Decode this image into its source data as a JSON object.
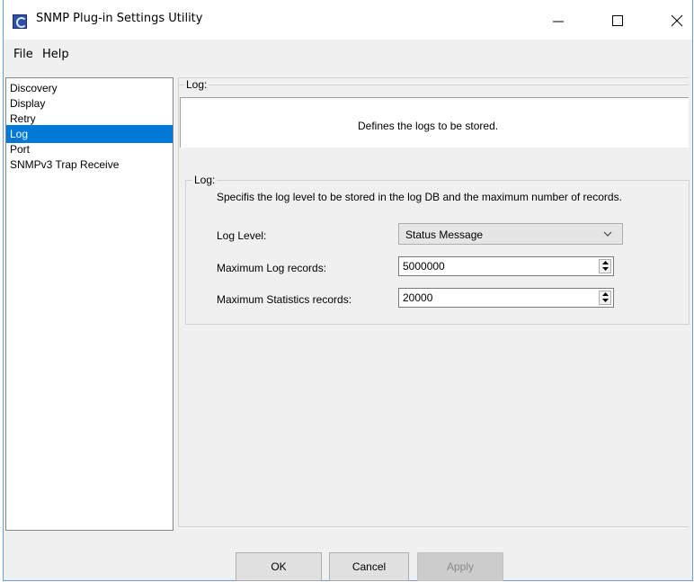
{
  "window": {
    "title": "SNMP Plug-in Settings Utility",
    "minimize_icon": "minimize-icon",
    "maximize_icon": "maximize-icon",
    "close_icon": "close-icon"
  },
  "menu": {
    "file": "File",
    "help": "Help"
  },
  "sidebar": {
    "items": [
      {
        "label": "Discovery",
        "selected": false
      },
      {
        "label": "Display",
        "selected": false
      },
      {
        "label": "Retry",
        "selected": false
      },
      {
        "label": "Log",
        "selected": true
      },
      {
        "label": "Port",
        "selected": false
      },
      {
        "label": "SNMPv3 Trap Receive",
        "selected": false
      }
    ]
  },
  "panel": {
    "group_title": "Log:",
    "description": "Defines the logs to be stored.",
    "settings_group_title": "Log:",
    "settings_intro": "Specifis the log level to be stored in the log DB and the maximum number of records.",
    "log_level_label": "Log Level:",
    "log_level_value": "Status Message",
    "max_log_label": "Maximum Log records:",
    "max_log_value": "5000000",
    "max_stats_label": "Maximum Statistics records:",
    "max_stats_value": "20000"
  },
  "buttons": {
    "ok": "OK",
    "cancel": "Cancel",
    "apply": "Apply"
  },
  "colors": {
    "selection": "#0078d7",
    "window_border": "#6f9fd8",
    "background": "#f0f0f0"
  }
}
